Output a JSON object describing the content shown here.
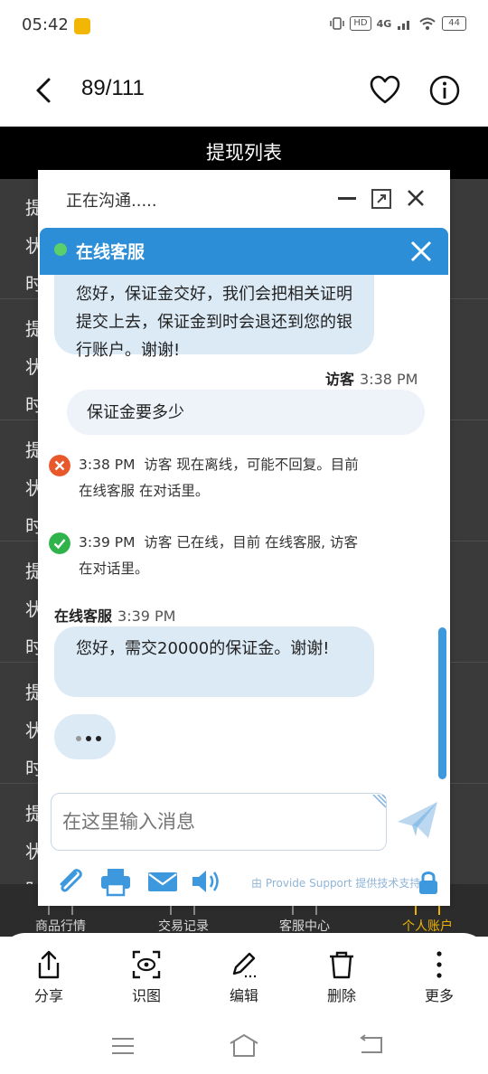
{
  "status_bar": {
    "time": "05:42",
    "indicators": [
      "vibrate-icon",
      "HD",
      "4G",
      "signal-icon",
      "wifi-icon"
    ],
    "hd_label": "HD",
    "network": "4G",
    "battery": "44"
  },
  "title_bar": {
    "counter": "89/111"
  },
  "background_app": {
    "header_title": "提现列表",
    "row_labels": [
      "提",
      "状",
      "时"
    ],
    "tabs": [
      "商品行情",
      "交易记录",
      "客服中心",
      "个人账户"
    ],
    "active_tab_color": "#f0b400"
  },
  "chat": {
    "status_text": "正在沟通.....",
    "header_title": "在线客服",
    "accent_color": "#2d8ed8",
    "messages": {
      "agent1_text": "您好，保证金交好，我们会把相关证明提交上去，保证金到时会退还到您的银行账户。谢谢!",
      "visitor_name": "访客",
      "visitor_time": "3:38 PM",
      "visitor_text": "保证金要多少",
      "sys1_time": "3:38 PM",
      "sys1_text": "访客 现在离线，可能不回复。目前",
      "sys1_text2": "在线客服 在对话里。",
      "sys2_time": "3:39 PM",
      "sys2_text": "访客 已在线，目前 在线客服, 访客",
      "sys2_text2": "在对话里。",
      "agent_name": "在线客服",
      "agent_time": "3:39 PM",
      "agent2_text": "您好，需交20000的保证金。谢谢!"
    },
    "input_placeholder": "在这里输入消息",
    "footer_icons": [
      "paperclip-icon",
      "printer-icon",
      "email-icon",
      "speaker-icon"
    ],
    "powered_by": "由 Provide Support 提供技术支持"
  },
  "action_sheet": {
    "share": "分享",
    "recognize": "识图",
    "edit": "编辑",
    "delete": "删除",
    "more": "更多"
  }
}
